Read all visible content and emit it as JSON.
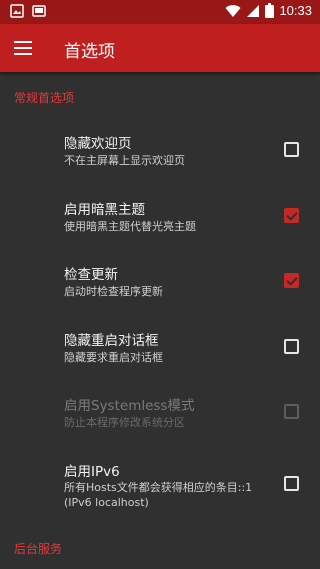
{
  "status_bar": {
    "time": "10:33",
    "left_icons": [
      "image-icon",
      "screenshot-icon"
    ],
    "right_icons": [
      "wifi-icon",
      "signal-icon",
      "battery-icon"
    ]
  },
  "app_bar": {
    "title": "首选项",
    "menu_icon": "hamburger-menu-icon"
  },
  "colors": {
    "status_bar": "#9a1717",
    "app_bar": "#c01f1f",
    "accent": "#c62828",
    "background": "#303030"
  },
  "sections": {
    "general": {
      "label": "常规首选项"
    },
    "background": {
      "label": "后台服务"
    }
  },
  "preferences": [
    {
      "title": "隐藏欢迎页",
      "summary": "不在主屏幕上显示欢迎页",
      "checked": false,
      "enabled": true
    },
    {
      "title": "启用暗黑主题",
      "summary": "使用暗黑主题代替光亮主题",
      "checked": true,
      "enabled": true
    },
    {
      "title": "检查更新",
      "summary": "启动时检查程序更新",
      "checked": true,
      "enabled": true
    },
    {
      "title": "隐藏重启对话框",
      "summary": "隐藏要求重启对话框",
      "checked": false,
      "enabled": true
    },
    {
      "title": "启用Systemless模式",
      "summary": "防止本程序修改系统分区",
      "checked": false,
      "enabled": false
    },
    {
      "title": "启用IPv6",
      "summary": "所有Hosts文件都会获得相应的条目::1 (IPv6 localhost)",
      "checked": false,
      "enabled": true
    }
  ]
}
